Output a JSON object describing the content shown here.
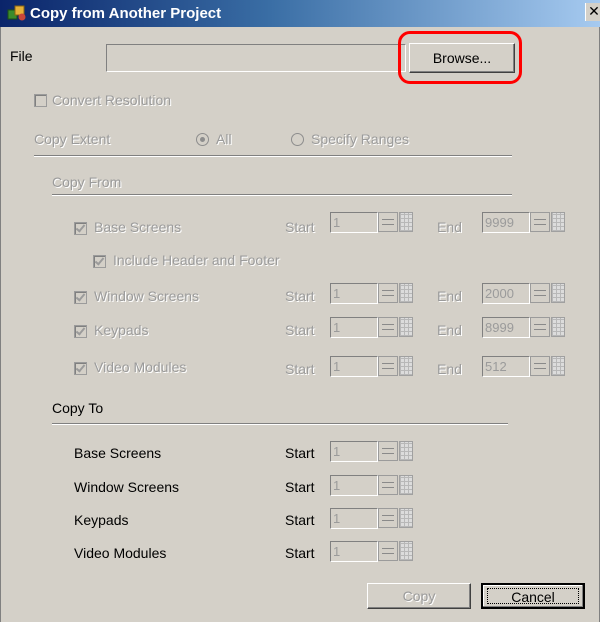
{
  "window": {
    "title": "Copy from Another Project",
    "close_glyph": "✕",
    "title_icon": "app-icon"
  },
  "file": {
    "label": "File",
    "value": "",
    "browse_label": "Browse..."
  },
  "convert_resolution": {
    "label": "Convert Resolution",
    "checked": false
  },
  "copy_extent": {
    "label": "Copy Extent",
    "options": [
      {
        "label": "All",
        "selected": true
      },
      {
        "label": "Specify Ranges",
        "selected": false
      }
    ]
  },
  "copy_from": {
    "title": "Copy From",
    "start_label": "Start",
    "end_label": "End",
    "include_header_footer": {
      "label": "Include Header and Footer",
      "checked": true
    },
    "rows": [
      {
        "label": "Base Screens",
        "checked": true,
        "start": "1",
        "end": "9999"
      },
      {
        "label": "Window Screens",
        "checked": true,
        "start": "1",
        "end": "2000"
      },
      {
        "label": "Keypads",
        "checked": true,
        "start": "1",
        "end": "8999"
      },
      {
        "label": "Video Modules",
        "checked": true,
        "start": "1",
        "end": "512"
      }
    ]
  },
  "copy_to": {
    "title": "Copy To",
    "start_label": "Start",
    "rows": [
      {
        "label": "Base Screens",
        "start": "1"
      },
      {
        "label": "Window Screens",
        "start": "1"
      },
      {
        "label": "Keypads",
        "start": "1"
      },
      {
        "label": "Video Modules",
        "start": "1"
      }
    ]
  },
  "buttons": {
    "copy_label": "Copy",
    "cancel_label": "Cancel"
  },
  "colors": {
    "dialog_bg": "#d4d0c8",
    "title_bar": "#0a246a",
    "highlight": "#ff0000",
    "disabled_text": "#9b9b9b"
  }
}
